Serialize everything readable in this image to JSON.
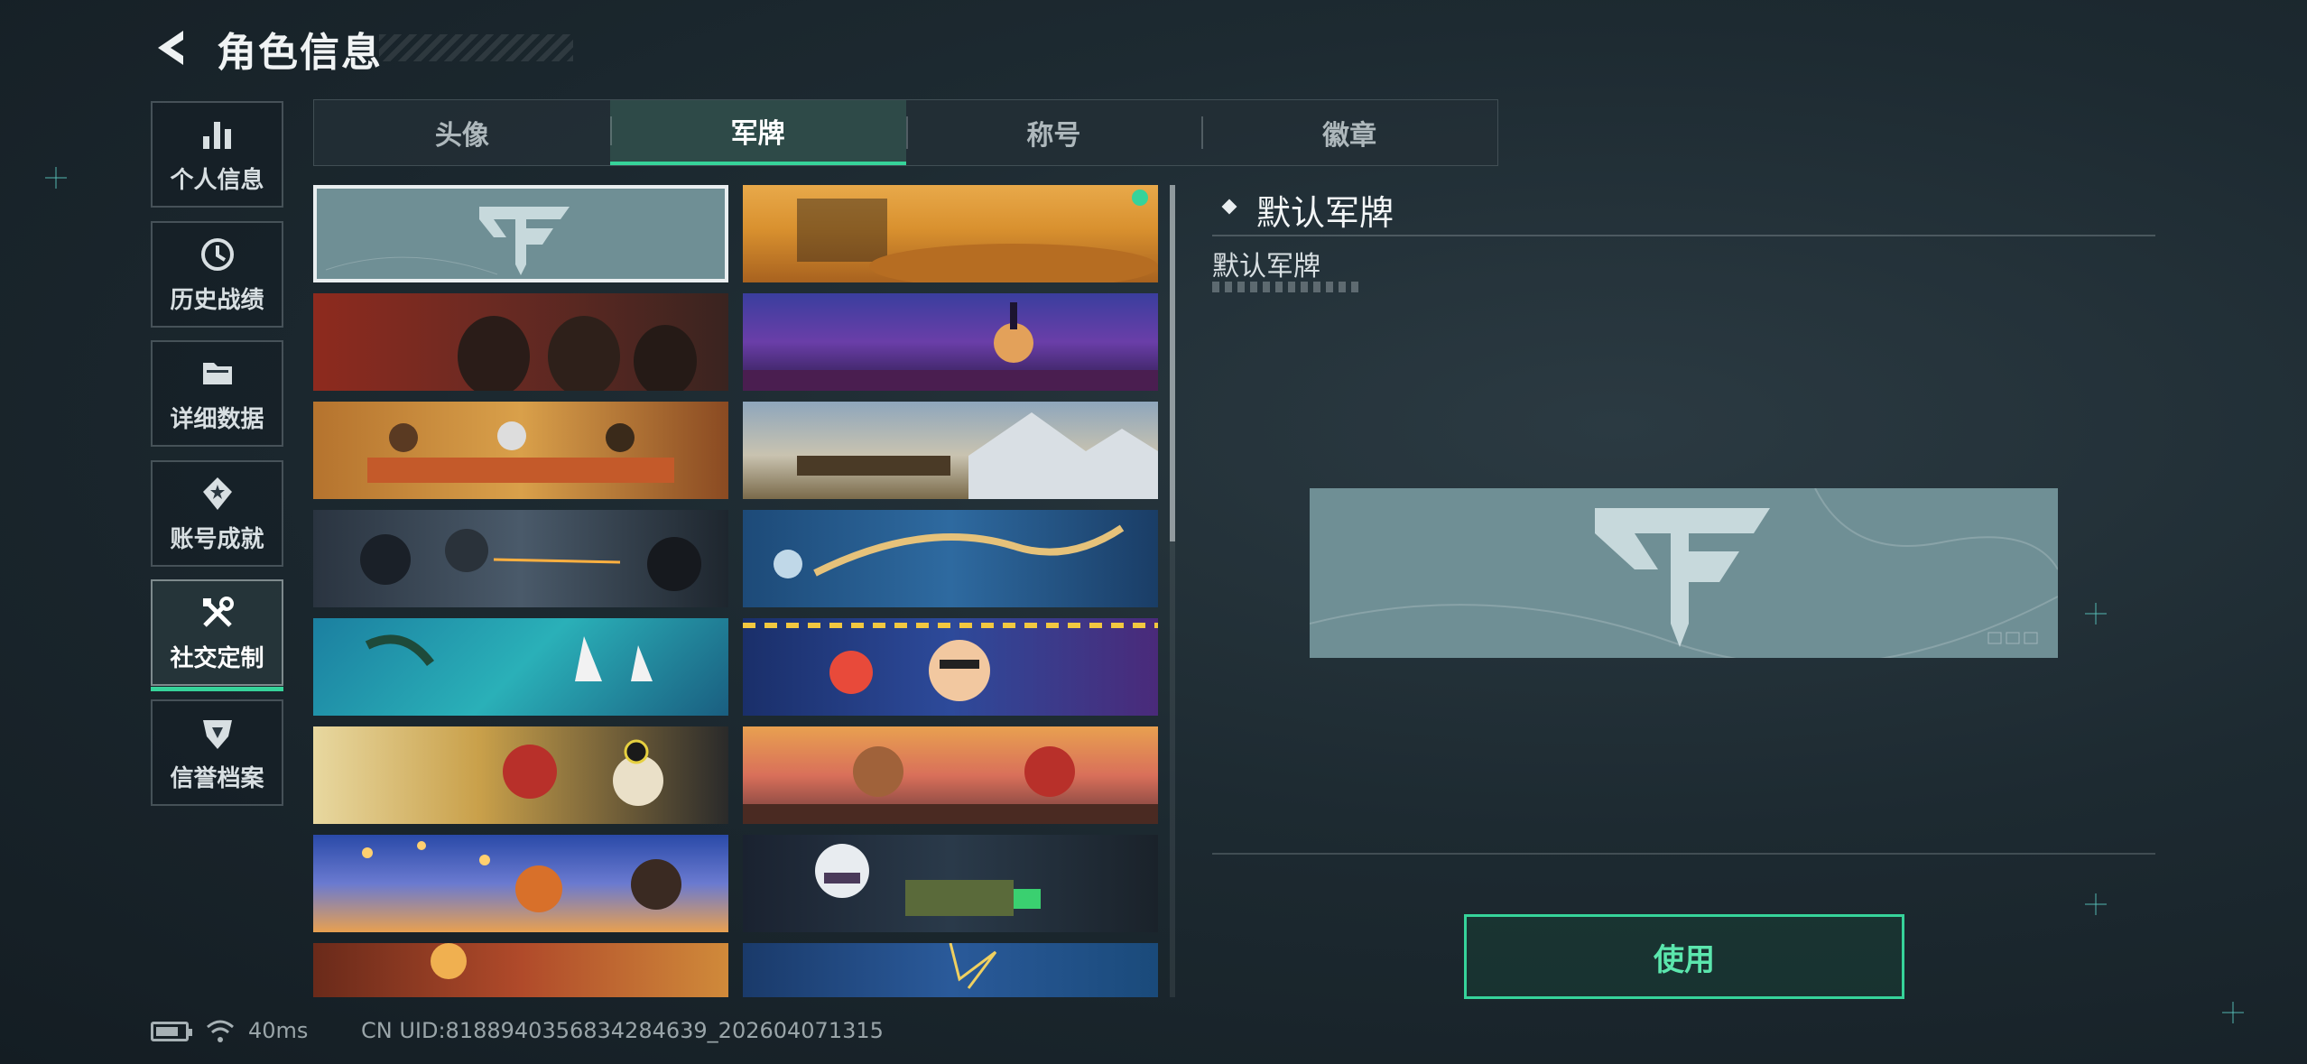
{
  "header": {
    "title": "角色信息",
    "back_icon": "back-arrow-icon"
  },
  "nav": [
    {
      "label": "个人信息",
      "icon": "bar-chart-icon",
      "active": false
    },
    {
      "label": "历史战绩",
      "icon": "history-clock-icon",
      "active": false
    },
    {
      "label": "详细数据",
      "icon": "folder-icon",
      "active": false
    },
    {
      "label": "账号成就",
      "icon": "achievement-badge-icon",
      "active": false
    },
    {
      "label": "社交定制",
      "icon": "tools-icon",
      "active": true
    },
    {
      "label": "信誉档案",
      "icon": "credit-shield-icon",
      "active": false
    }
  ],
  "tabs": [
    {
      "label": "头像",
      "active": false
    },
    {
      "label": "军牌",
      "active": true
    },
    {
      "label": "称号",
      "active": false
    },
    {
      "label": "徽章",
      "active": false
    }
  ],
  "cards": [
    {
      "theme": "default-logo",
      "selected": true,
      "locked": false
    },
    {
      "theme": "desert-melting-clocks",
      "selected": false,
      "locked": false,
      "new_dot": true
    },
    {
      "theme": "soldiers-red-brown",
      "selected": false,
      "locked": false
    },
    {
      "theme": "day-of-dead-skull",
      "selected": false,
      "locked": false
    },
    {
      "theme": "feast-table",
      "selected": false,
      "locked": false
    },
    {
      "theme": "mountain-sniper",
      "selected": false,
      "locked": false
    },
    {
      "theme": "night-raid",
      "selected": false,
      "locked": false
    },
    {
      "theme": "phoenix-embroidery",
      "selected": false,
      "locked": false
    },
    {
      "theme": "sailboats-sea",
      "selected": false,
      "locked": false
    },
    {
      "theme": "fiesta-cartoon",
      "selected": false,
      "locked": false
    },
    {
      "theme": "red-helmet-soldier",
      "selected": false,
      "locked": false
    },
    {
      "theme": "sunset-cartoon",
      "selected": false,
      "locked": false
    },
    {
      "theme": "lantern-festival",
      "selected": false,
      "locked": false
    },
    {
      "theme": "chibi-girl-gear",
      "selected": false,
      "locked": false
    },
    {
      "theme": "orange-explosion",
      "selected": false,
      "locked": true
    },
    {
      "theme": "blue-burst",
      "selected": false,
      "locked": true
    }
  ],
  "detail": {
    "title": "默认军牌",
    "subtitle": "默认军牌",
    "use_button": "使用"
  },
  "status": {
    "ping": "40ms",
    "uid": "CN UID:818894035683428463​9_202604071315"
  },
  "colors": {
    "accent": "#36d39a",
    "selected_border": "#e9eef0",
    "default_tag": "#6f8f95"
  }
}
